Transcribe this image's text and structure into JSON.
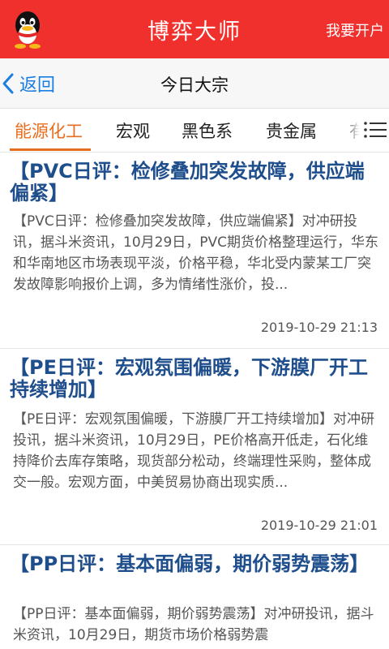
{
  "header": {
    "app_title": "博弈大师",
    "open_account": "我要开户",
    "logo_icon": "qq-penguin-icon",
    "bg_color": "#f0302c"
  },
  "nav": {
    "back_label": "返回",
    "page_title": "今日大宗"
  },
  "tabs": [
    {
      "label": "能源化工",
      "active": true
    },
    {
      "label": "宏观",
      "active": false
    },
    {
      "label": "黑色系",
      "active": false
    },
    {
      "label": "贵金属",
      "active": false
    },
    {
      "label": "有",
      "active": false
    }
  ],
  "accent_color": "#e86d1d",
  "articles": [
    {
      "headline": "【PVC日评：检修叠加突发故障，供应端偏紧】",
      "summary": "【PVC日评：检修叠加突发故障，供应端偏紧】对冲研投讯，据斗米资讯，10月29日，PVC期货价格整理运行，华东和华南地区市场表现平淡，价格平稳，华北受内蒙某工厂突发故障影响报价上调，多为情绪性涨价，投...",
      "time": "2019-10-29 21:13"
    },
    {
      "headline": "【PE日评：宏观氛围偏暖，下游膜厂开工持续增加】",
      "summary": "【PE日评：宏观氛围偏暖，下游膜厂开工持续增加】对冲研投讯，据斗米资讯，10月29日，PE价格高开低走，石化维持降价去库存策略，现货部分松动，终端理性采购，整体成交一般。宏观方面，中美贸易协商出现实质...",
      "time": "2019-10-29 21:01"
    },
    {
      "headline": "【PP日评：基本面偏弱，期价弱势震荡】",
      "summary": "【PP日评：基本面偏弱，期价弱势震荡】对冲研投讯，据斗米资讯，10月29日，期货市场价格弱势震",
      "time": ""
    }
  ]
}
